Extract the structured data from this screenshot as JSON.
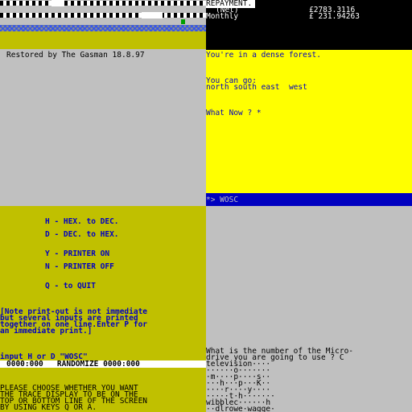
{
  "top_left": {
    "credit": "Restored by The Gasman 18.8.97"
  },
  "top_right": {
    "repayment_label": "REPAYMENT.",
    "net_label": "(Net)",
    "net_value": "£2783.3116",
    "monthly_label": "Monthly",
    "monthly_value": "£ 231.94263",
    "location": "You're in a dense forest.",
    "exits_label": "You can go:",
    "exits": "north south east  west",
    "prompt": "What Now ? *",
    "input_line": "*> WOSC"
  },
  "bottom_left": {
    "menu": [
      "H - HEX. to DEC.",
      "D - DEC. to HEX.",
      "Y - PRINTER ON",
      "N - PRINTER OFF",
      "Q - to QUIT"
    ],
    "note": [
      "[Note print-out is not immediate",
      "but several inputs are printed",
      "together on one line.Enter P for",
      "an immediate print.]"
    ],
    "input_prompt": "input H or D \"WOSC\"",
    "address_line": "0000:000   RANDOMIZE 0000:000",
    "trace_text": [
      "PLEASE CHOOSE WHETHER YOU WANT",
      "THE TRACE DISPLAY TO BE ON THE",
      "TOP OR BOTTOM LINE OF THE SCREEN",
      "BY USING KEYS Q OR A."
    ]
  },
  "bottom_right": {
    "question": [
      "What is the number of the Micro-",
      "drive you are going to use ? C"
    ],
    "grid": [
      "television····",
      "······o·······",
      "·m····p····s··",
      "···h···p···K··",
      "····r····y····",
      "·····t·h·······",
      "wibblec······h",
      "··dlrowe·wagge·"
    ]
  }
}
